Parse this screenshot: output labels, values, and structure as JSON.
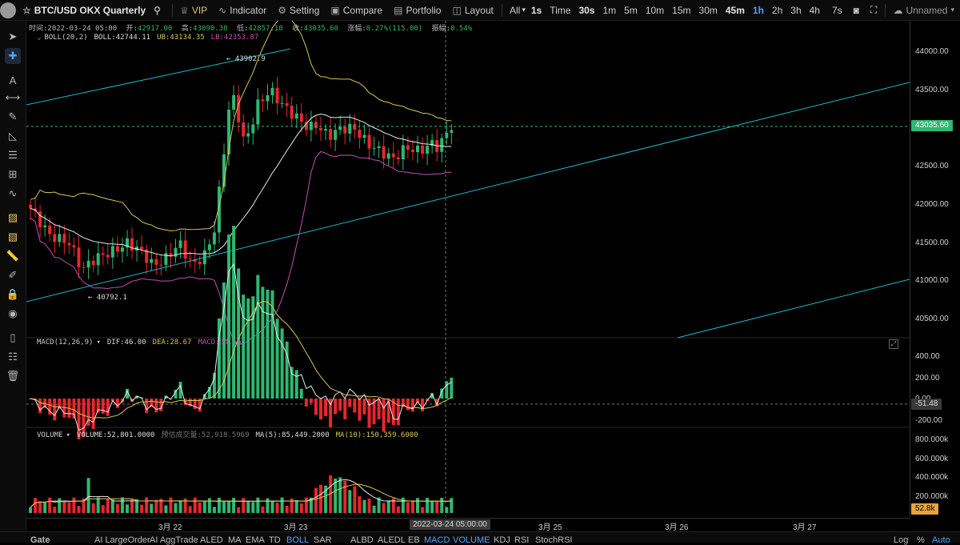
{
  "toolbar": {
    "symbol": "BTC/USD OKX Quarterly",
    "vip": "VIP",
    "indicator": "Indicator",
    "setting": "Setting",
    "compare": "Compare",
    "portfolio": "Portfolio",
    "layout": "Layout",
    "all": "All",
    "intervals": [
      "1s",
      "Time",
      "30s",
      "1m",
      "5m",
      "10m",
      "15m",
      "30m",
      "45m",
      "1h",
      "2h",
      "3h",
      "4h"
    ],
    "selected_interval": "1h",
    "interval_7s": "7s",
    "layout_name": "Unnamed"
  },
  "ohlc": {
    "time_label": "时间:",
    "time": "2022-03-24 05:00",
    "open_label": "开:",
    "open": "42917.00",
    "high_label": "高:",
    "high": "43090.30",
    "low_label": "低:",
    "low": "42857.10",
    "close_label": "收:",
    "close": "43035.60",
    "change_label": "涨幅:",
    "change": "0.27%(115.00)",
    "amp_label": "振幅:",
    "amp": "0.54%"
  },
  "boll": {
    "name": "BOLL(20,2)",
    "mid": "BOLL:42744.11",
    "ub": "UB:43134.35",
    "lb": "LB:42353.87"
  },
  "macd": {
    "name": "MACD(12,26,9)",
    "dif": "DIF:46.00",
    "dea": "DEA:28.67",
    "macd": "MACD:34.66"
  },
  "volume": {
    "name": "VOLUME",
    "vol": "VOLUME:52,801.0000",
    "est": "预估成交量:52,918.5969",
    "ma5": "MA(5):85,449.2000",
    "ma10": "MA(10):150,359.6000"
  },
  "price_axis": {
    "labels": [
      "44000.00",
      "43500.00",
      "43000.00",
      "42500.00",
      "42000.00",
      "41500.00",
      "41000.00",
      "40500.00"
    ],
    "current": "43035.60"
  },
  "macd_axis": {
    "labels": [
      "400.00",
      "200.00",
      "0.00",
      "-200.00"
    ],
    "current": "-51.48"
  },
  "volume_axis": {
    "labels": [
      "800.000k",
      "600.000k",
      "400.000k",
      "200.000k"
    ],
    "current": "52.8k"
  },
  "annotations": {
    "high": "← 43902.9",
    "low": "← 40792.1"
  },
  "time_axis": {
    "labels": [
      "3月 22",
      "3月 23",
      "3月 25",
      "3月 26",
      "3月 27"
    ],
    "crosshair": "2022-03-24 05:00:00"
  },
  "bottom": {
    "gate": "Gate",
    "items": [
      "AI LargeOrder",
      "AI AggTrade",
      "ALED",
      "MA",
      "EMA",
      "TD",
      "BOLL",
      "SAR",
      "ALBD",
      "ALEDL",
      "EB",
      "MACD",
      "VOLUME",
      "KDJ",
      "RSI",
      "StochRSI"
    ],
    "active": [
      "BOLL",
      "MACD",
      "VOLUME"
    ],
    "log": "Log",
    "pct": "%",
    "auto": "Auto"
  },
  "colors": {
    "up": "#2eb872",
    "down": "#e8262e",
    "boll_mid": "#e8e8e8",
    "boll_ub": "#d7c650",
    "boll_lb": "#c64fb3",
    "trend": "#1fb6c9",
    "accent": "#4fa3ff",
    "price_tag": "#e8a43a"
  }
}
